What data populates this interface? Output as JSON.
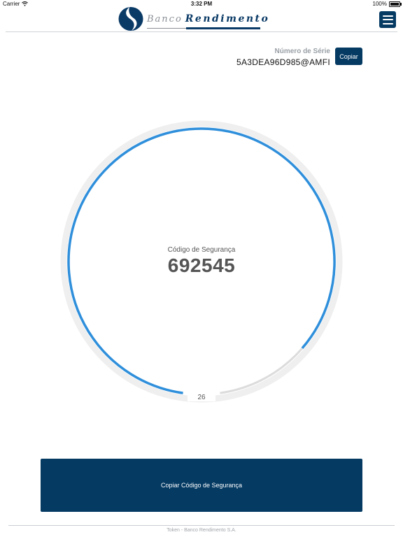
{
  "status_bar": {
    "carrier": "Carrier",
    "time": "3:32 PM",
    "battery": "100%",
    "icons": [
      "wifi-icon",
      "battery-icon"
    ]
  },
  "header": {
    "logo_word_1": "Banco",
    "logo_word_2": "Rendimento",
    "menu_icon": "hamburger-menu-icon"
  },
  "serial": {
    "label": "Número de Série",
    "value": "5A3DEA96D985@AMFI",
    "copy_label": "Copiar"
  },
  "token": {
    "label": "Código de Segurança",
    "code": "692545",
    "seconds_remaining": "26",
    "progress_fraction": 0.88
  },
  "actions": {
    "copy_code_label": "Copiar Código de Segurança"
  },
  "footer": {
    "text": "Token - Banco Rendimento S.A."
  },
  "colors": {
    "brand_navy": "#053a63",
    "ring_progress": "#2f8fdb",
    "ring_track": "#eeeeee",
    "ring_remaining": "#dedede"
  }
}
